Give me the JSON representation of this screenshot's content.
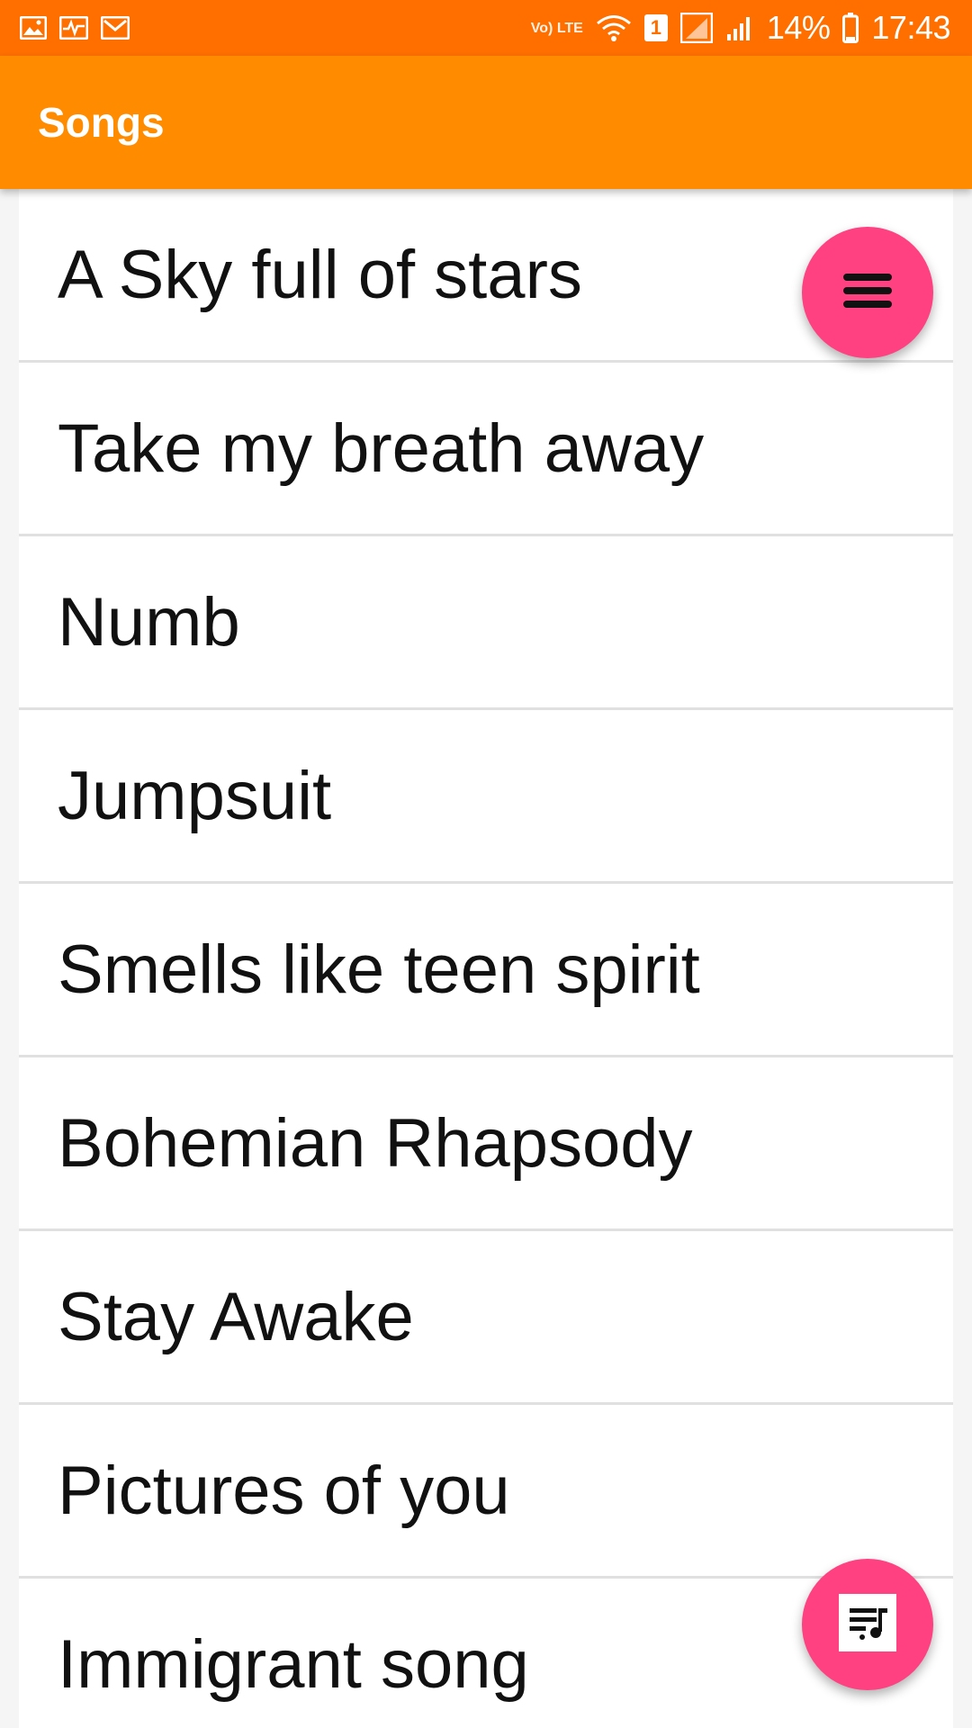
{
  "status_bar": {
    "network_label": "Vo) LTE",
    "sim_label": "1",
    "battery_percent": "14%",
    "time": "17:43"
  },
  "app_bar": {
    "title": "Songs"
  },
  "songs": [
    "A Sky full of stars",
    "Take my breath away",
    "Numb",
    "Jumpsuit",
    "Smells like teen spirit",
    "Bohemian Rhapsody",
    "Stay Awake",
    "Pictures of you",
    "Immigrant song"
  ],
  "fabs": {
    "menu_icon": "menu-icon",
    "playlist_icon": "queue-music-icon"
  },
  "colors": {
    "status_bar": "#ff6f00",
    "app_bar": "#ff8c00",
    "accent": "#ff4081"
  }
}
